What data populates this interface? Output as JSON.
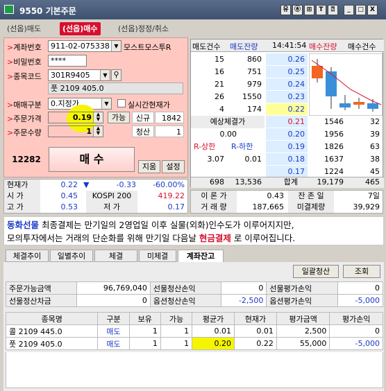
{
  "window": {
    "title": "9550 기본주문",
    "title_buttons": [
      "유",
      "㉭",
      "⊞",
      "T",
      "⍰",
      "_",
      "□",
      "X"
    ]
  },
  "order_tabs": [
    "(선옵)매도",
    "(선옵)매수",
    "(선옵)정정/취소"
  ],
  "order": {
    "account_label": "계좌번호",
    "account_no": "911-02-075338",
    "account_name": "모스트모스투R",
    "password_label": "비밀번호",
    "password": "****",
    "code_label": "종목코드",
    "code": "301R9405",
    "code_name": "풋 2109 405.0",
    "trade_type_label": "매매구분",
    "trade_type": "0.지정가",
    "realtime_label": "실시간현재가",
    "price_label": "주문가격",
    "price": "0.19",
    "available_btn": "가능",
    "new_label": "신규",
    "new_qty": "1842",
    "qty_label": "주문수량",
    "qty": "1",
    "clear_label": "청산",
    "clear_qty": "1",
    "order_count": "12282",
    "buy_btn": "매 수",
    "clear_btn": "지움",
    "settings_btn": "설정"
  },
  "orderbook": {
    "headers": [
      "매도건수",
      "매도잔량",
      "14:41:54",
      "매수잔량",
      "매수건수"
    ],
    "asks": [
      {
        "count": "15",
        "qty": "860",
        "price": "0.26"
      },
      {
        "count": "16",
        "qty": "751",
        "price": "0.25"
      },
      {
        "count": "21",
        "qty": "979",
        "price": "0.24"
      },
      {
        "count": "26",
        "qty": "1550",
        "price": "0.23"
      },
      {
        "count": "4",
        "qty": "174",
        "price": "0.22"
      }
    ],
    "bids": [
      {
        "price": "0.21",
        "qty": "1546",
        "count": "32"
      },
      {
        "price": "0.20",
        "qty": "1956",
        "count": "39"
      },
      {
        "price": "0.19",
        "qty": "1826",
        "count": "63"
      },
      {
        "price": "0.18",
        "qty": "1637",
        "count": "38"
      },
      {
        "price": "0.17",
        "qty": "1224",
        "count": "45"
      }
    ],
    "expected_label": "예상체결가",
    "expected_price": "0.00",
    "r_high_label": "R-상한",
    "r_low_label": "R-하한",
    "r_high": "3.07",
    "r_low": "0.01",
    "total_ask_count": "698",
    "total_ask_qty": "13,536",
    "total_label": "합계",
    "total_bid_qty": "19,179",
    "total_bid_count": "465"
  },
  "market_info": {
    "current_label": "현재가",
    "current": "0.22",
    "change": "-0.33",
    "change_pct": "-60.00%",
    "open_label": "시 가",
    "open": "0.45",
    "index_label": "KOSPI 200",
    "index": "419.22",
    "high_label": "고 가",
    "high": "0.53",
    "low_label": "저 가",
    "low": "0.17",
    "theo_label": "이 론 가",
    "theo": "0.43",
    "remain_label": "잔 존 일",
    "remain": "7일",
    "volume_label": "거 래 량",
    "volume": "187,665",
    "oi_label": "미결제량",
    "oi": "39,929"
  },
  "notice": {
    "tag": "동화선물",
    "text1": " 최종결제는 만기일의 2영업일 이후 실물(외화)인수도가 이루어지지만,",
    "text2": "모의투자에서는 거래의 단순화를 위해 만기일 다음날 ",
    "emph": "현금결제",
    "text3": " 로 이루어집니다."
  },
  "bottom_tabs": [
    "체결추이",
    "일별추이",
    "체결",
    "미체결",
    "계좌잔고"
  ],
  "balance": {
    "bulk_clear_btn": "일괄청산",
    "query_btn": "조회",
    "rows": [
      [
        "주문가능금액",
        "96,769,040",
        "선물청산손익",
        "0",
        "선물평가손익",
        "0"
      ],
      [
        "선물정산차금",
        "0",
        "옵션청산손익",
        "-2,500",
        "옵션평가손익",
        "-5,000"
      ]
    ],
    "columns": [
      "종목명",
      "구분",
      "보유",
      "가능",
      "평균가",
      "현재가",
      "평가금액",
      "평가손익"
    ],
    "positions": [
      [
        "콜 2109 445.0",
        "매도",
        "1",
        "1",
        "0.01",
        "0.01",
        "2,500",
        "0"
      ],
      [
        "풋 2109 405.0",
        "매도",
        "1",
        "1",
        "0.20",
        "0.22",
        "55,000",
        "-5,000"
      ]
    ]
  },
  "colors": {
    "accent": "#d80f2e",
    "blue": "#1b39c6",
    "panel": "#ffc9c1",
    "highlight": "#f5f500"
  }
}
